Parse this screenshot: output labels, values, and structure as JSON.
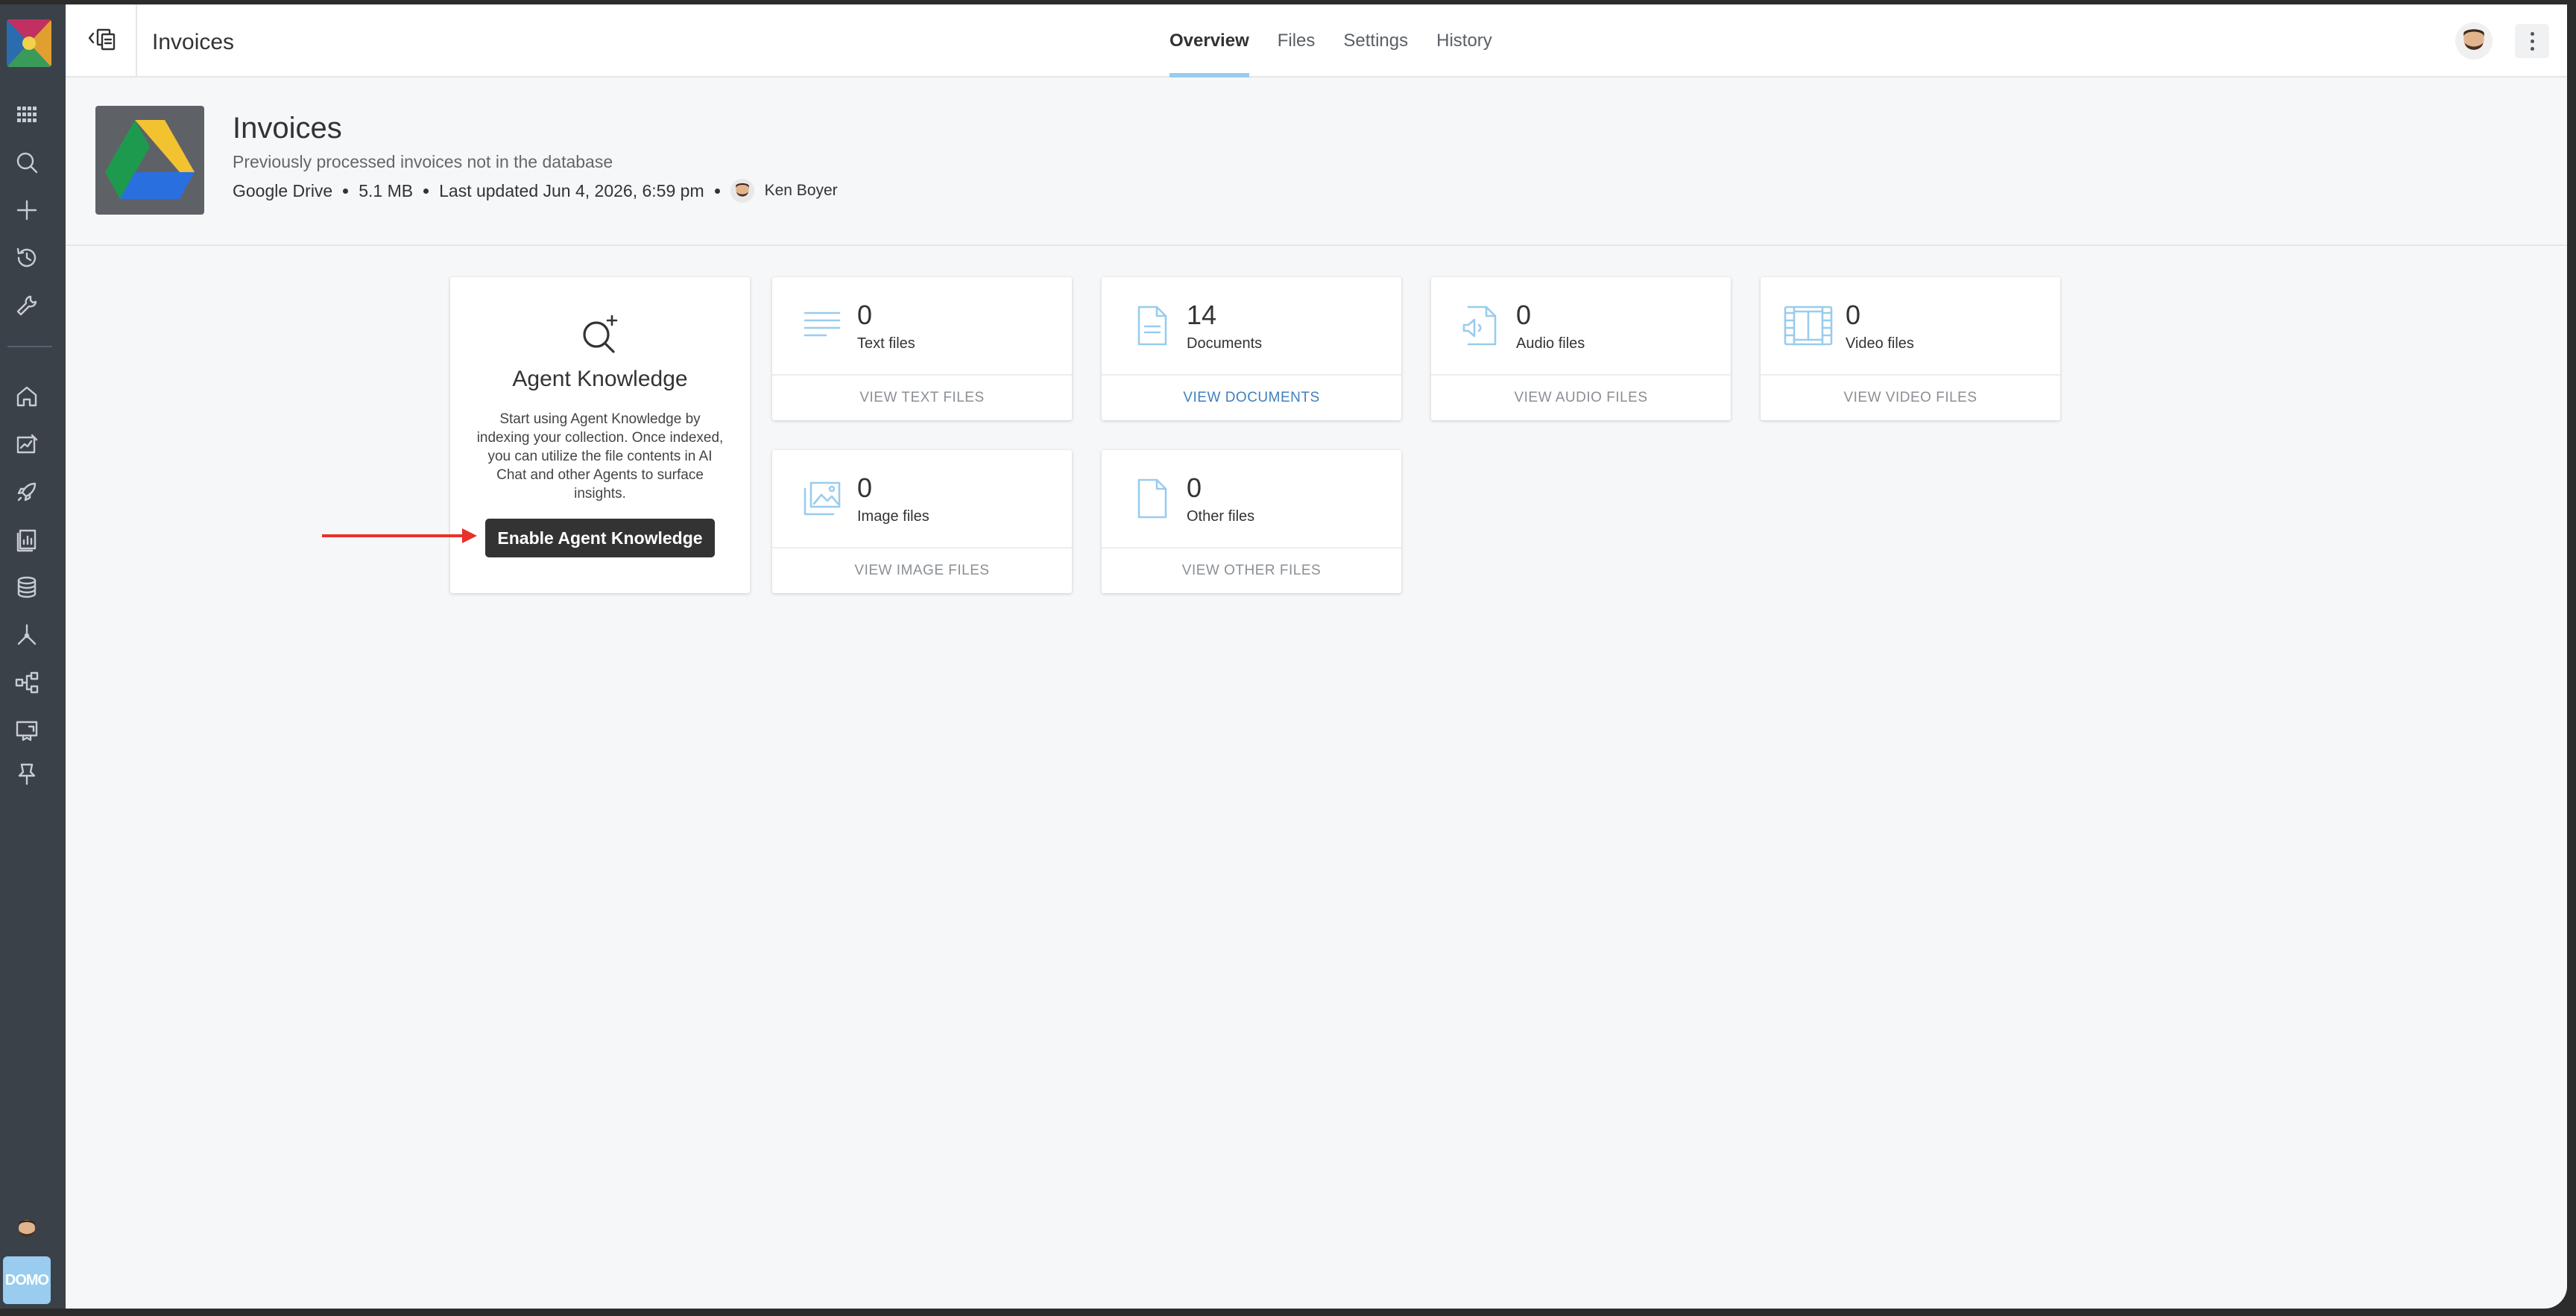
{
  "topbar": {
    "title": "Invoices",
    "tabs": [
      {
        "label": "Overview",
        "active": true
      },
      {
        "label": "Files",
        "active": false
      },
      {
        "label": "Settings",
        "active": false
      },
      {
        "label": "History",
        "active": false
      }
    ]
  },
  "header": {
    "title": "Invoices",
    "description": "Previously processed invoices not in the database",
    "source": "Google Drive",
    "size": "5.1 MB",
    "last_updated": "Last updated Jun 4, 2026, 6:59 pm",
    "owner": "Ken Boyer"
  },
  "agent_card": {
    "title": "Agent Knowledge",
    "description": "Start using Agent Knowledge by indexing your collection. Once indexed, you can utilize the file contents in AI Chat and other Agents to surface insights.",
    "button_label": "Enable Agent Knowledge"
  },
  "file_cards": [
    {
      "icon": "text-lines-icon",
      "count": "0",
      "label": "Text files",
      "action": "VIEW TEXT FILES",
      "enabled": false
    },
    {
      "icon": "document-icon",
      "count": "14",
      "label": "Documents",
      "action": "VIEW DOCUMENTS",
      "enabled": true
    },
    {
      "icon": "audio-file-icon",
      "count": "0",
      "label": "Audio files",
      "action": "VIEW AUDIO FILES",
      "enabled": false
    },
    {
      "icon": "video-film-icon",
      "count": "0",
      "label": "Video files",
      "action": "VIEW VIDEO FILES",
      "enabled": false
    },
    {
      "icon": "image-file-icon",
      "count": "0",
      "label": "Image files",
      "action": "VIEW IMAGE FILES",
      "enabled": false
    },
    {
      "icon": "blank-file-icon",
      "count": "0",
      "label": "Other files",
      "action": "VIEW OTHER FILES",
      "enabled": false
    }
  ],
  "sidebar": {
    "brand_label": "DOMO",
    "items": [
      "apps-grid-icon",
      "search-icon",
      "plus-icon",
      "history-icon",
      "wrench-icon",
      "home-icon",
      "edit-chart-icon",
      "rocket-icon",
      "report-icon",
      "database-icon",
      "dataflow-icon",
      "workflow-icon",
      "learn-icon",
      "pin-icon"
    ]
  },
  "colors": {
    "accent": "#99ccee",
    "link": "#3f7fbf",
    "sidebar_bg": "#3b4148",
    "button_dark": "#333333",
    "annotation_arrow": "#e8322a"
  }
}
